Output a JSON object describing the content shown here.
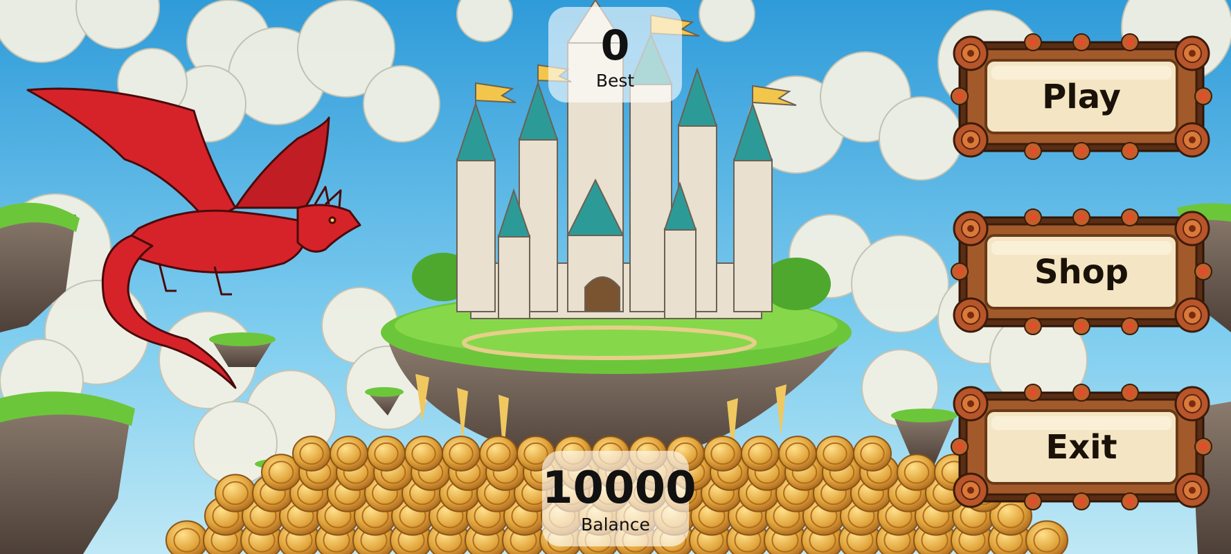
{
  "stats": {
    "best": {
      "value": "0",
      "label": "Best"
    },
    "balance": {
      "value": "10000",
      "label": "Balance"
    }
  },
  "menu": [
    {
      "label": "Play"
    },
    {
      "label": "Shop"
    },
    {
      "label": "Exit"
    }
  ],
  "colors": {
    "sky_top": "#3aa6e0",
    "sky_bottom": "#9fdcf2",
    "grass": "#6cc63a",
    "rock": "#7a6a5e",
    "castle_wall": "#e9e0cf",
    "roof": "#2c9b98",
    "flag": "#f2c64a",
    "dragon": "#d6232a",
    "coin": "#d9982a",
    "button_frame": "#8c4a24",
    "button_face": "#f4e6c4"
  },
  "icons": [
    "dragon",
    "castle",
    "floating-island",
    "coin-pile",
    "cloud"
  ]
}
